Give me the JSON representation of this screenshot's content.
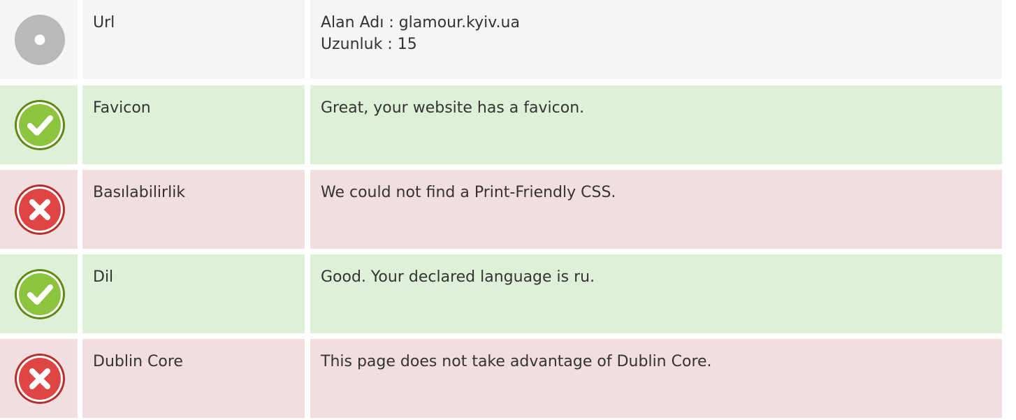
{
  "colors": {
    "neutral_bg": "#f5f5f5",
    "pass_bg": "#dff0d8",
    "fail_bg": "#f2dede",
    "text": "#333333"
  },
  "rows": [
    {
      "status": "neutral",
      "icon": "info-circle-icon",
      "label": "Url",
      "lines": [
        "Alan Adı : glamour.kyiv.ua",
        "Uzunluk : 15"
      ]
    },
    {
      "status": "pass",
      "icon": "check-circle-icon",
      "label": "Favicon",
      "lines": [
        "Great, your website has a favicon."
      ]
    },
    {
      "status": "fail",
      "icon": "x-circle-icon",
      "label": "Basılabilirlik",
      "lines": [
        "We could not find a Print-Friendly CSS."
      ]
    },
    {
      "status": "pass",
      "icon": "check-circle-icon",
      "label": "Dil",
      "lines": [
        "Good. Your declared language is ru."
      ]
    },
    {
      "status": "fail",
      "icon": "x-circle-icon",
      "label": "Dublin Core",
      "lines": [
        "This page does not take advantage of Dublin Core."
      ]
    }
  ]
}
